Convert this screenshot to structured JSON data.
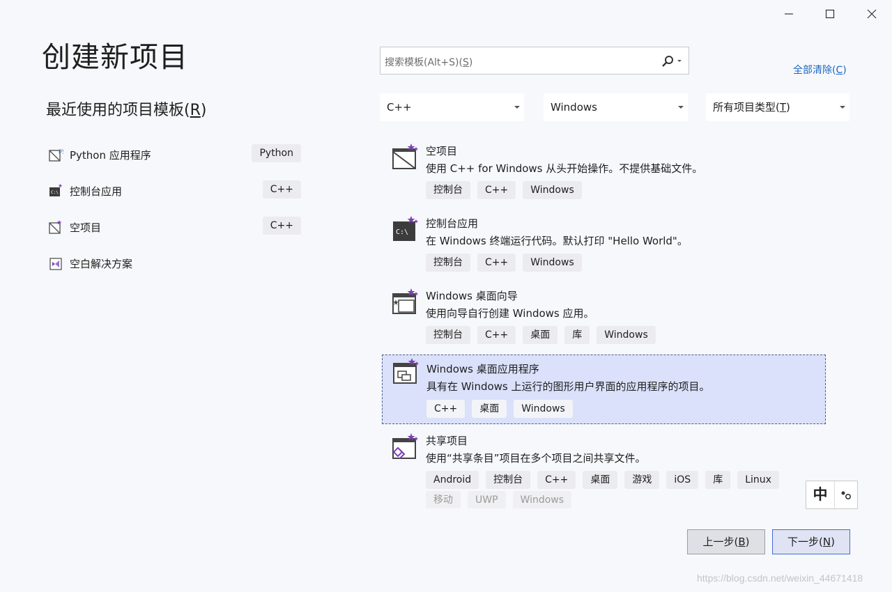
{
  "window": {
    "minimize_icon": "minimize-icon",
    "maximize_icon": "maximize-icon",
    "close_icon": "close-icon"
  },
  "page_title": "创建新项目",
  "recent": {
    "title_prefix": "最近使用的项目模板(",
    "title_key": "R",
    "title_suffix": ")",
    "items": [
      {
        "label": "Python 应用程序",
        "lang": "Python",
        "icon": "python-app-icon"
      },
      {
        "label": "控制台应用",
        "lang": "C++",
        "icon": "console-app-icon"
      },
      {
        "label": "空项目",
        "lang": "C++",
        "icon": "empty-project-icon"
      },
      {
        "label": "空白解决方案",
        "lang": "",
        "icon": "blank-solution-icon"
      }
    ]
  },
  "search": {
    "placeholder_prefix": "搜索模板(Alt+S)(",
    "placeholder_key": "S",
    "placeholder_suffix": ")",
    "icon": "search-icon"
  },
  "clear_all": {
    "prefix": "全部清除(",
    "key": "C",
    "suffix": ")"
  },
  "filters": {
    "language": "C++",
    "platform": "Windows",
    "type_prefix": "所有项目类型(",
    "type_key": "T",
    "type_suffix": ")"
  },
  "templates": [
    {
      "name": "空项目",
      "description": "使用 C++ for Windows 从头开始操作。不提供基础文件。",
      "tags": [
        "控制台",
        "C++",
        "Windows"
      ],
      "icon": "empty-project-icon"
    },
    {
      "name": "控制台应用",
      "description": "在 Windows 终端运行代码。默认打印 \"Hello World\"。",
      "tags": [
        "控制台",
        "C++",
        "Windows"
      ],
      "icon": "console-app-icon"
    },
    {
      "name": "Windows 桌面向导",
      "description": "使用向导自行创建 Windows 应用。",
      "tags": [
        "控制台",
        "C++",
        "桌面",
        "库",
        "Windows"
      ],
      "icon": "desktop-wizard-icon"
    },
    {
      "name": "Windows 桌面应用程序",
      "description": "具有在 Windows 上运行的图形用户界面的应用程序的项目。",
      "tags": [
        "C++",
        "桌面",
        "Windows"
      ],
      "icon": "desktop-app-icon",
      "selected": true
    },
    {
      "name": "共享项目",
      "description": "使用“共享条目”项目在多个项目之间共享文件。",
      "tags": [
        "Android",
        "控制台",
        "C++",
        "桌面",
        "游戏",
        "iOS",
        "库",
        "Linux"
      ],
      "tags_faded": [
        "移动",
        "UWP",
        "Windows"
      ],
      "icon": "shared-project-icon"
    }
  ],
  "ime": {
    "mode": "中",
    "icon": "ime-punctuation-icon"
  },
  "buttons": {
    "back_prefix": "上一步(",
    "back_key": "B",
    "back_suffix": ")",
    "next_prefix": "下一步(",
    "next_key": "N",
    "next_suffix": ")"
  },
  "watermark": "https://blog.csdn.net/weixin_44671418",
  "colors": {
    "accent": "#3f6ed0",
    "link": "#1a66c4",
    "selected_bg": "#dbe1fa",
    "vs_purple": "#7b3fb6"
  }
}
